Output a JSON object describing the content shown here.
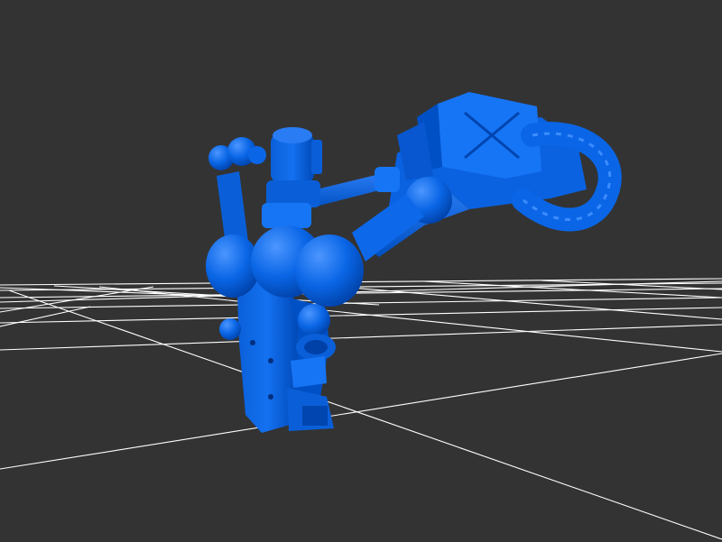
{
  "viewport": {
    "background_color": "#333333",
    "grid_color": "#ffffff",
    "model_color": "#0a66e6",
    "model_highlight": "#3d8cff",
    "model_shadow": "#0047b3"
  },
  "model": {
    "icon": "robot-arm-icon"
  }
}
